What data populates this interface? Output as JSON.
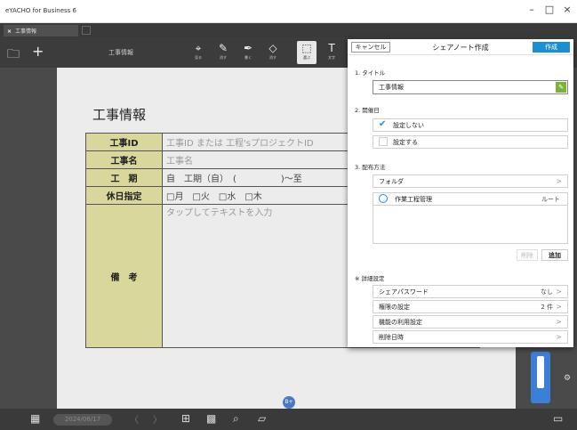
{
  "window": {
    "title": "eYACHO for Business 6",
    "min": "–",
    "max": "□",
    "close": "×"
  },
  "tab": {
    "close": "×",
    "label": "工事情報"
  },
  "toolbar": {
    "doc_title": "工事情報",
    "folder_icon": "folder-icon",
    "add_icon": "plus-icon",
    "tools": [
      {
        "name": "view",
        "label": "見る",
        "glyph": "⌖"
      },
      {
        "name": "erase",
        "label": "消す",
        "glyph": "✎"
      },
      {
        "name": "write",
        "label": "書く",
        "glyph": "✒"
      },
      {
        "name": "eraser",
        "label": "消す",
        "glyph": "◇"
      },
      {
        "name": "select",
        "label": "選ぶ",
        "glyph": "⬚"
      },
      {
        "name": "text",
        "label": "文字",
        "glyph": "T"
      }
    ]
  },
  "sheet": {
    "title": "工事情報",
    "rows": [
      {
        "label": "工事ID",
        "value": "工事ID または 工程'sプロジェクトID"
      },
      {
        "label": "工事名",
        "value": "工事名"
      },
      {
        "label": "工　期",
        "value": "自　工期（自）　(　　　　　)～至"
      },
      {
        "label": "休日指定",
        "value": "□月　□火　□水　□木"
      },
      {
        "label": "備　考",
        "value": "タップしてテキストを入力"
      }
    ]
  },
  "popup": {
    "cancel": "キャンセル",
    "title": "シェアノート作成",
    "create": "作成",
    "sec_title": "1. タイトル",
    "title_value": "工事情報",
    "sec_hold": "2. 開催日",
    "hold_options": [
      {
        "label": "設定しない",
        "checked": true
      },
      {
        "label": "設定する",
        "checked": false
      }
    ],
    "sec_distribute": "3. 配布方法",
    "distribute_folder": "フォルダ",
    "folder_item": {
      "name": "作業工程管理",
      "tag": "ルート"
    },
    "delete": "削除",
    "add": "追加",
    "sec_detail": "※ 詳細設定",
    "details": [
      {
        "label": "シェアパスワード",
        "value": "なし"
      },
      {
        "label": "権限の設定",
        "value": "2 件"
      },
      {
        "label": "機能の利用設定",
        "value": ""
      },
      {
        "label": "削除日時",
        "value": ""
      }
    ]
  },
  "bottombar": {
    "date": "2024/06/17",
    "prev": "〈",
    "next": "〉"
  },
  "fab": {
    "label": "B+"
  },
  "colors": {
    "accent": "#1a8fd6",
    "label_bg": "#d9d79b",
    "toolbar": "#3c3c3c"
  }
}
